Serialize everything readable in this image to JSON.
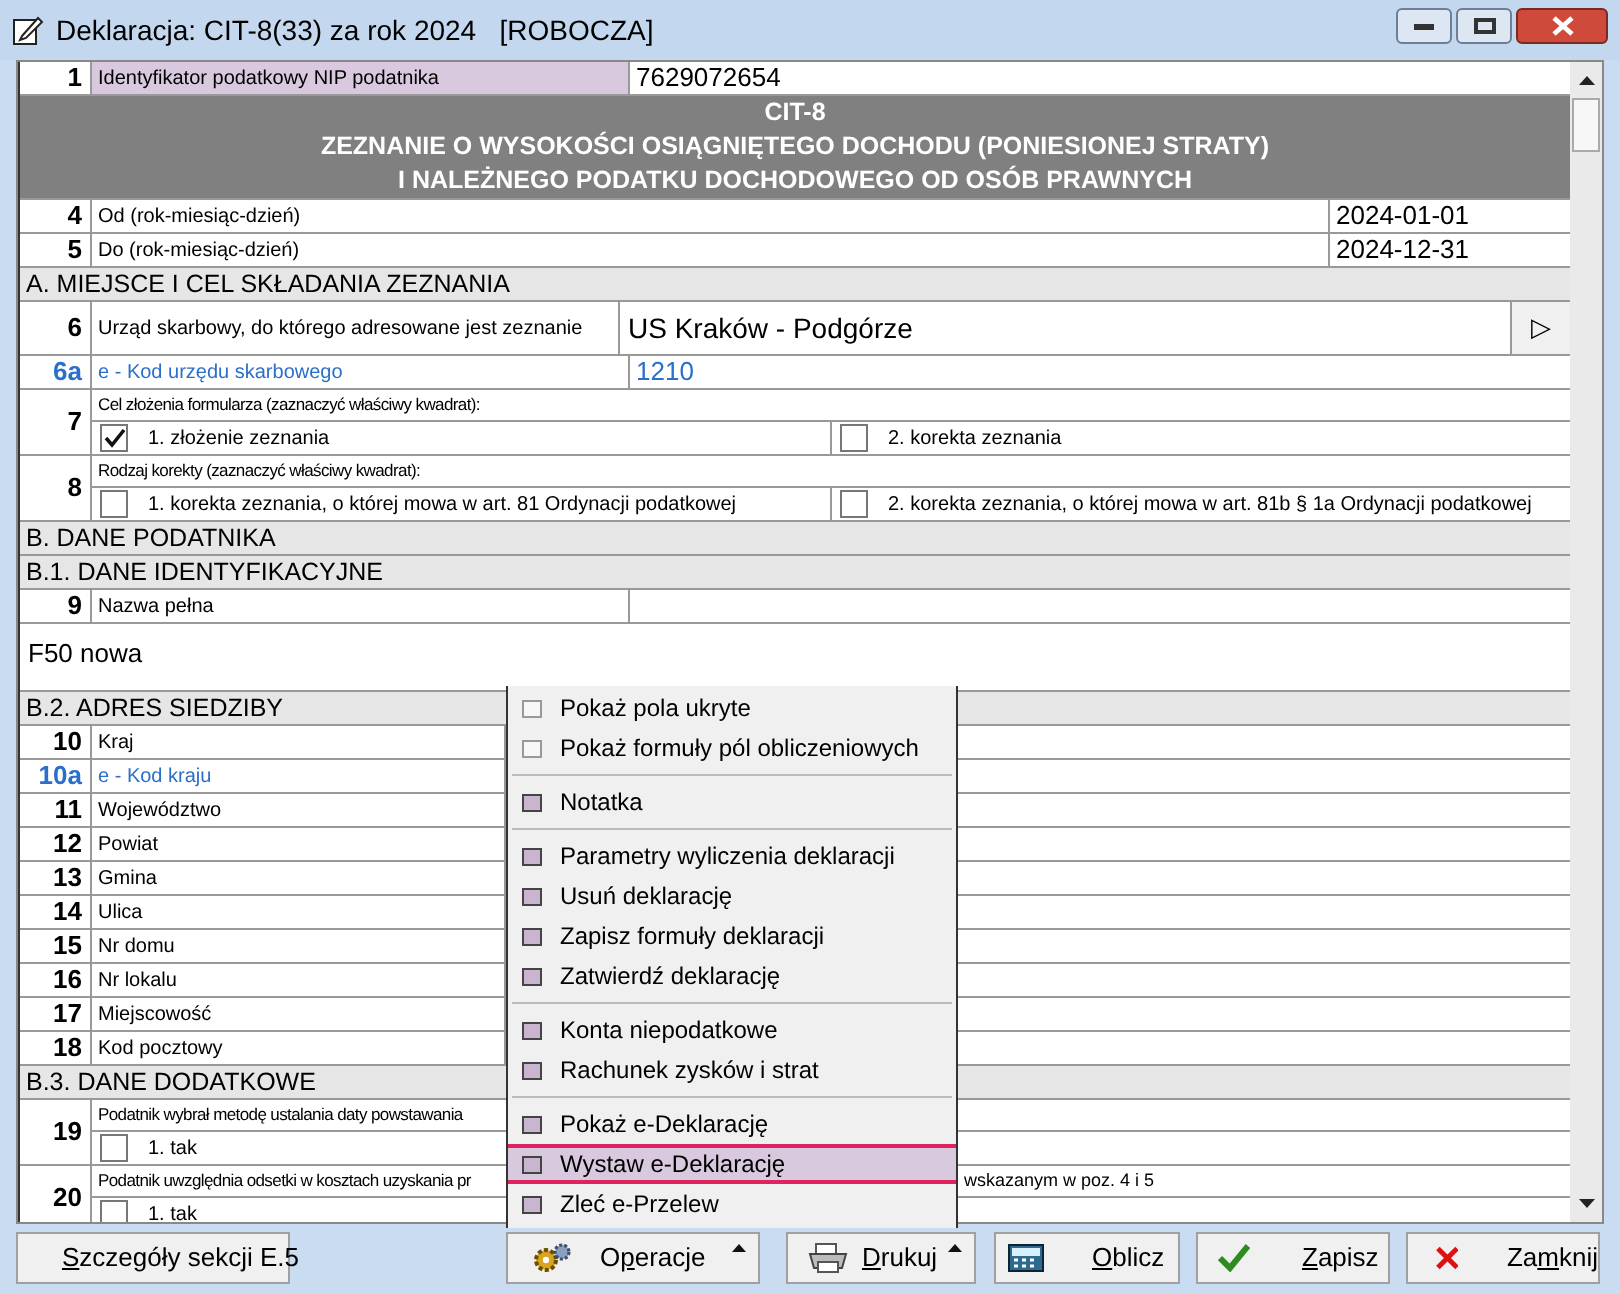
{
  "window": {
    "title": "Deklaracja: CIT-8(33) za rok 2024   [ROBOCZA]"
  },
  "form": {
    "rows": [
      {
        "kind": "field",
        "number": "1",
        "label": "Identyfikator podatkowy NIP podatnika",
        "value": "7629072654",
        "selected": true
      },
      {
        "kind": "title",
        "lines": [
          "CIT-8",
          "ZEZNANIE O WYSOKOŚCI OSIĄGNIĘTEGO DOCHODU (PONIESIONEJ STRATY)",
          "I NALEŻNEGO PODATKU DOCHODOWEGO OD OSÓB PRAWNYCH"
        ]
      },
      {
        "kind": "date",
        "number": "4",
        "label": "Od (rok-miesiąc-dzień)",
        "value": "2024-01-01"
      },
      {
        "kind": "date",
        "number": "5",
        "label": "Do (rok-miesiąc-dzień)",
        "value": "2024-12-31"
      },
      {
        "kind": "section",
        "label": "A. MIEJSCE I CEL SKŁADANIA ZEZNANIA"
      },
      {
        "kind": "select",
        "number": "6",
        "label": "Urząd skarbowy, do którego adresowane jest zeznanie",
        "value": "US Kraków - Podgórze",
        "button": "▷"
      },
      {
        "kind": "efield",
        "number": "6a",
        "label": "e - Kod urzędu skarbowego",
        "value": "1210"
      },
      {
        "kind": "choice",
        "number": "7",
        "label": "Cel złożenia formularza (zaznaczyć właściwy kwadrat):",
        "options": [
          {
            "label": "1. złożenie zeznania",
            "checked": true
          },
          {
            "label": "2. korekta zeznania",
            "checked": false
          }
        ]
      },
      {
        "kind": "choice",
        "number": "8",
        "label": "Rodzaj korekty (zaznaczyć właściwy kwadrat):",
        "options": [
          {
            "label": "1.  korekta zeznania, o której mowa w art. 81 Ordynacji podatkowej",
            "checked": false
          },
          {
            "label": "2.  korekta zeznania, o której mowa w art. 81b § 1a Ordynacji podatkowej",
            "checked": false
          }
        ]
      },
      {
        "kind": "section",
        "label": "B. DANE PODATNIKA"
      },
      {
        "kind": "section",
        "label": "B.1. DANE IDENTYFIKACYJNE"
      },
      {
        "kind": "field",
        "number": "9",
        "label": "Nazwa pełna",
        "selected": false
      },
      {
        "kind": "text",
        "value": "F50 nowa"
      },
      {
        "kind": "section",
        "label": "B.2. ADRES SIEDZIBY"
      },
      {
        "kind": "address",
        "number": "10",
        "label": "Kraj"
      },
      {
        "kind": "eaddress",
        "number": "10a",
        "label": "e - Kod kraju"
      },
      {
        "kind": "address",
        "number": "11",
        "label": "Województwo"
      },
      {
        "kind": "address",
        "number": "12",
        "label": "Powiat"
      },
      {
        "kind": "address",
        "number": "13",
        "label": "Gmina"
      },
      {
        "kind": "address",
        "number": "14",
        "label": "Ulica"
      },
      {
        "kind": "address",
        "number": "15",
        "label": "Nr domu"
      },
      {
        "kind": "address",
        "number": "16",
        "label": "Nr lokalu"
      },
      {
        "kind": "address",
        "number": "17",
        "label": "Miejscowość"
      },
      {
        "kind": "address",
        "number": "18",
        "label": "Kod pocztowy"
      },
      {
        "kind": "section",
        "label": "B.3. DANE DODATKOWE"
      },
      {
        "kind": "choice",
        "number": "19",
        "label": "Podatnik wybrał metodę ustalania daty powstawania",
        "options": [
          {
            "label": "1. tak",
            "checked": false
          }
        ]
      },
      {
        "kind": "choice",
        "number": "20",
        "label": "Podatnik uwzględnia odsetki w kosztach uzyskania pr",
        "label_end": "wskazanym w poz. 4 i 5",
        "options": [
          {
            "label": "1. tak",
            "checked": false
          }
        ]
      }
    ]
  },
  "menu": {
    "groups": [
      [
        {
          "label": "Pokaż pola ukryte",
          "kind": "option",
          "selected": false
        },
        {
          "label": "Pokaż formuły pól obliczeniowych",
          "kind": "option",
          "selected": false
        }
      ],
      [
        {
          "label": "Notatka",
          "kind": "command",
          "selected": false
        }
      ],
      [
        {
          "label": "Parametry wyliczenia deklaracji",
          "kind": "command",
          "selected": false
        },
        {
          "label": "Usuń deklarację",
          "kind": "command",
          "selected": false
        },
        {
          "label": "Zapisz formuły deklaracji",
          "kind": "command",
          "selected": false
        },
        {
          "label": "Zatwierdź deklarację",
          "kind": "command",
          "selected": false
        }
      ],
      [
        {
          "label": "Konta niepodatkowe",
          "kind": "command",
          "selected": false
        },
        {
          "label": "Rachunek zysków i strat",
          "kind": "command",
          "selected": false
        }
      ],
      [
        {
          "label": "Pokaż e-Deklarację",
          "kind": "command",
          "selected": false
        },
        {
          "label": "Wystaw e-Deklarację",
          "kind": "command",
          "selected": true
        },
        {
          "label": "Zleć e-Przelew",
          "kind": "command",
          "selected": false
        }
      ]
    ]
  },
  "buttons": [
    {
      "kind": "details",
      "key": "S",
      "after": "zczegóły sekcji E.5"
    },
    {
      "kind": "operations",
      "before": "O",
      "key": "p",
      "after": "eracje"
    },
    {
      "kind": "print",
      "key": "D",
      "after": "rukuj"
    },
    {
      "kind": "calculate",
      "key": "O",
      "after": "blicz"
    },
    {
      "kind": "save",
      "key": "Z",
      "after": "apisz"
    },
    {
      "kind": "close",
      "before": "Za",
      "key": "m",
      "after": "knij"
    }
  ]
}
